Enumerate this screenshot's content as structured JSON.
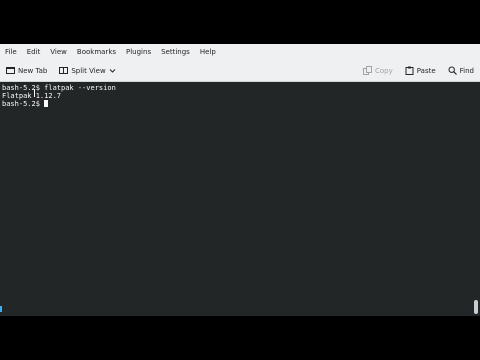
{
  "menubar": {
    "items": [
      "File",
      "Edit",
      "View",
      "Bookmarks",
      "Plugins",
      "Settings",
      "Help"
    ]
  },
  "toolbar": {
    "new_tab": "New Tab",
    "split_view": "Split View",
    "copy": "Copy",
    "paste": "Paste",
    "find": "Find"
  },
  "terminal": {
    "lines": [
      "bash-5.2$ flatpak --version",
      "Flatpak 1.12.7",
      "bash-5.2$ "
    ]
  },
  "colors": {
    "terminal_bg": "#232627",
    "terminal_fg": "#fcfcfc",
    "chrome_bg": "#eff0f1",
    "accent": "#3daee9"
  }
}
